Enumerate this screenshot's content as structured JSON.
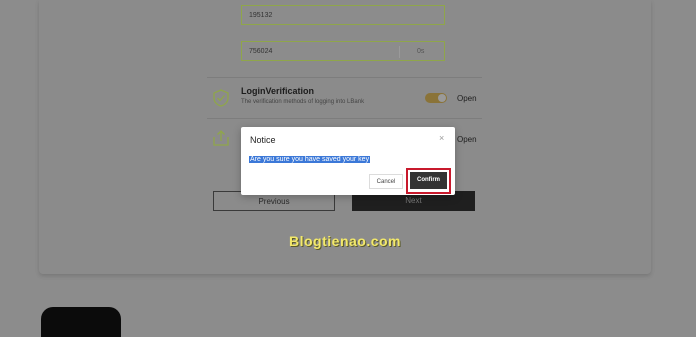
{
  "form": {
    "code1_value": "195132",
    "code2_value": "756024",
    "code2_suffix": "0s"
  },
  "login_verification": {
    "title": "LoginVerification",
    "description": "The verification methods of logging into LBank",
    "status": "Open",
    "toggle_on": true
  },
  "second_row": {
    "status": "Open"
  },
  "nav": {
    "previous_label": "Previous",
    "next_label": "Next"
  },
  "watermark": "Blogtienao.com",
  "dialog": {
    "title": "Notice",
    "close_glyph": "×",
    "message": "Are you sure you have saved your key",
    "cancel_label": "Cancel",
    "confirm_label": "Confirm",
    "highlight_color": "#c8192c"
  },
  "colors": {
    "accent": "#8fa64a",
    "selection": "#3b78d8"
  }
}
